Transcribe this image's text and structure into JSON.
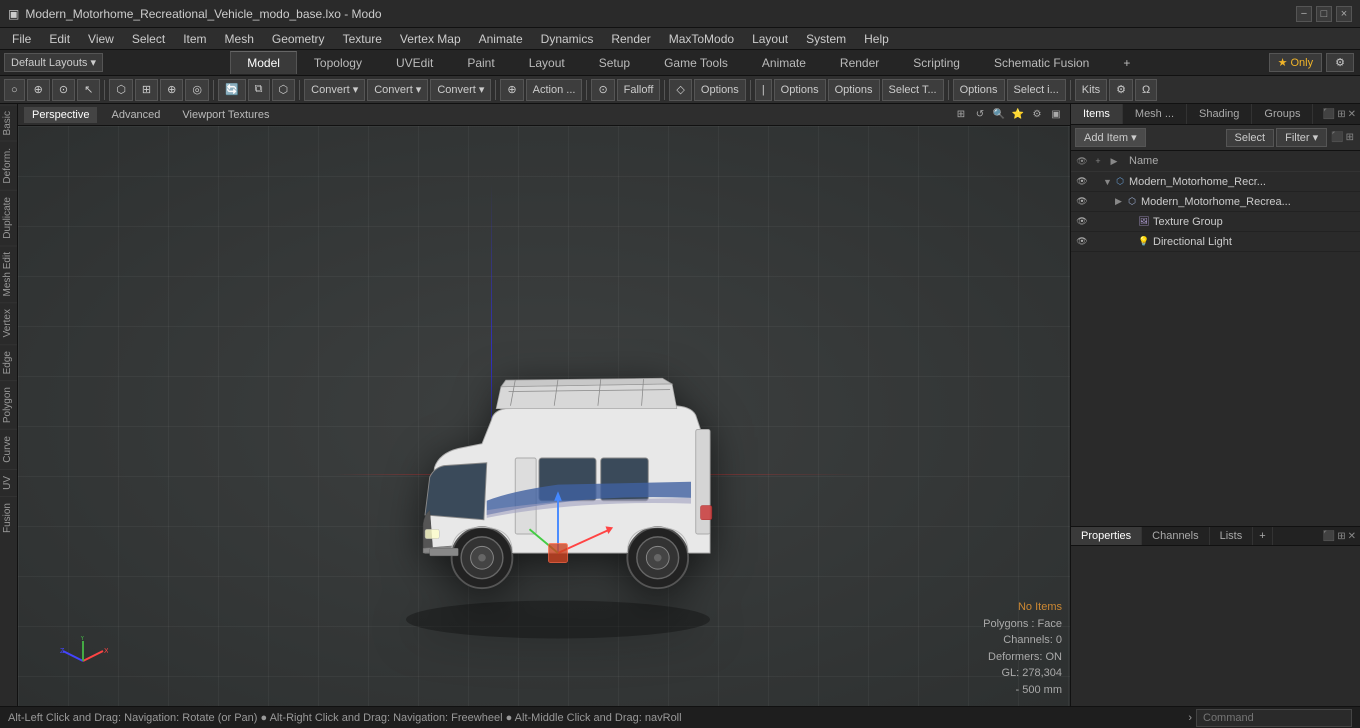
{
  "titlebar": {
    "title": "Modern_Motorhome_Recreational_Vehicle_modo_base.lxo - Modo",
    "app_icon": "▣"
  },
  "titlebar_controls": {
    "minimize": "−",
    "maximize": "□",
    "close": "×"
  },
  "menubar": {
    "items": [
      "File",
      "Edit",
      "View",
      "Select",
      "Item",
      "Mesh",
      "Geometry",
      "Texture",
      "Vertex Map",
      "Animate",
      "Dynamics",
      "Render",
      "MaxToModo",
      "Layout",
      "System",
      "Help"
    ]
  },
  "tabsbar": {
    "layout_selector": "Default Layouts ▾",
    "tabs": [
      {
        "label": "Model",
        "active": true
      },
      {
        "label": "Topology",
        "active": false
      },
      {
        "label": "UVEdit",
        "active": false
      },
      {
        "label": "Paint",
        "active": false
      },
      {
        "label": "Layout",
        "active": false
      },
      {
        "label": "Setup",
        "active": false
      },
      {
        "label": "Game Tools",
        "active": false
      },
      {
        "label": "Animate",
        "active": false
      },
      {
        "label": "Render",
        "active": false
      },
      {
        "label": "Scripting",
        "active": false
      },
      {
        "label": "Schematic Fusion",
        "active": false
      }
    ],
    "plus_btn": "+",
    "only_btn": "★ Only",
    "settings_btn": "⚙"
  },
  "toolbar": {
    "buttons": [
      {
        "label": "○",
        "icon": true,
        "title": "select-circle"
      },
      {
        "label": "⊕",
        "icon": true,
        "title": "select-lasso"
      },
      {
        "label": "⊙",
        "icon": true,
        "title": "select-element"
      },
      {
        "label": "↖",
        "icon": true,
        "title": "select-arrow"
      },
      {
        "label": "⬡",
        "icon": true,
        "title": "snap-grid"
      },
      {
        "label": "⊞",
        "icon": true,
        "title": "snap-mesh"
      },
      {
        "label": "⊕",
        "icon": true,
        "title": "move-pivot"
      },
      {
        "label": "◎",
        "icon": true,
        "title": "pivot"
      },
      {
        "label": "🔄",
        "icon": true,
        "title": "symmetry"
      },
      {
        "label": "⧉",
        "icon": true,
        "title": "poly-cage"
      },
      {
        "label": "⬡",
        "icon": true,
        "title": "ngon"
      },
      {
        "label": "Convert ▾",
        "icon": false,
        "title": "convert1"
      },
      {
        "label": "Convert ▾",
        "icon": false,
        "title": "convert2"
      },
      {
        "label": "Convert ▾",
        "icon": false,
        "title": "convert3"
      },
      {
        "label": "⊕",
        "icon": true,
        "title": "move"
      },
      {
        "label": "Action ...",
        "icon": false,
        "title": "action"
      },
      {
        "label": "⊙",
        "icon": true,
        "title": "falloff-icon"
      },
      {
        "label": "Falloff",
        "icon": false,
        "title": "falloff"
      },
      {
        "label": "◇",
        "icon": true,
        "title": "sym-icon"
      },
      {
        "label": "Options",
        "icon": false,
        "title": "options1"
      },
      {
        "label": "|",
        "icon": true,
        "title": "sep1"
      },
      {
        "label": "Options",
        "icon": false,
        "title": "options2"
      },
      {
        "label": "Options",
        "icon": false,
        "title": "options3"
      },
      {
        "label": "Select T...",
        "icon": false,
        "title": "select-t"
      },
      {
        "label": "Options",
        "icon": false,
        "title": "options4"
      },
      {
        "label": "Select i...",
        "icon": false,
        "title": "select-i"
      },
      {
        "label": "Kits",
        "icon": false,
        "title": "kits"
      },
      {
        "label": "⚙",
        "icon": true,
        "title": "gear"
      },
      {
        "label": "Ω",
        "icon": true,
        "title": "omega"
      }
    ]
  },
  "viewport": {
    "tabs": [
      "Perspective",
      "Advanced",
      "Viewport Textures"
    ],
    "active_tab": "Perspective",
    "icons": [
      "⊞",
      "↺",
      "🔍",
      "⭐",
      "⚙",
      "▣"
    ]
  },
  "viewport_status": {
    "no_items": "No Items",
    "polygons": "Polygons : Face",
    "channels": "Channels: 0",
    "deformers": "Deformers: ON",
    "gl": "GL: 278,304",
    "scale": "- 500 mm"
  },
  "left_sidebar_tabs": [
    "Basic",
    "Deform.",
    "Duplicate",
    "Mesh Edit",
    "Vertex",
    "Edge",
    "Polygon",
    "Curve",
    "UV",
    "Fusion"
  ],
  "scene_panel": {
    "tabs": [
      "Items",
      "Mesh ...",
      "Shading",
      "Groups"
    ],
    "active_tab": "Items",
    "toolbar": {
      "add_item": "Add Item",
      "add_item_arrow": "▾",
      "select_btn": "Select",
      "filter_btn": "Filter",
      "filter_arrow": "▾"
    },
    "header": {
      "name_col": "Name"
    },
    "items": [
      {
        "id": "item1",
        "label": "Modern_Motorhome_Recr...",
        "icon": "⬡",
        "indent": 0,
        "has_expand": true,
        "expanded": true,
        "type": "mesh_group"
      },
      {
        "id": "item2",
        "label": "Modern_Motorhome_Recrea...",
        "icon": "⬡",
        "indent": 1,
        "has_expand": true,
        "expanded": false,
        "type": "mesh"
      },
      {
        "id": "item3",
        "label": "Texture Group",
        "icon": "🖼",
        "indent": 2,
        "has_expand": false,
        "expanded": false,
        "type": "texture"
      },
      {
        "id": "item4",
        "label": "Directional Light",
        "icon": "💡",
        "indent": 2,
        "has_expand": false,
        "expanded": false,
        "type": "light"
      }
    ]
  },
  "properties_panel": {
    "tabs": [
      "Properties",
      "Channels",
      "Lists"
    ],
    "active_tab": "Properties",
    "plus_btn": "+",
    "content": ""
  },
  "statusbar": {
    "hint": "Alt-Left Click and Drag: Navigation: Rotate (or Pan) ● Alt-Right Click and Drag: Navigation: Freewheel ● Alt-Middle Click and Drag: navRoll",
    "arrow": "›",
    "command_placeholder": "Command"
  }
}
